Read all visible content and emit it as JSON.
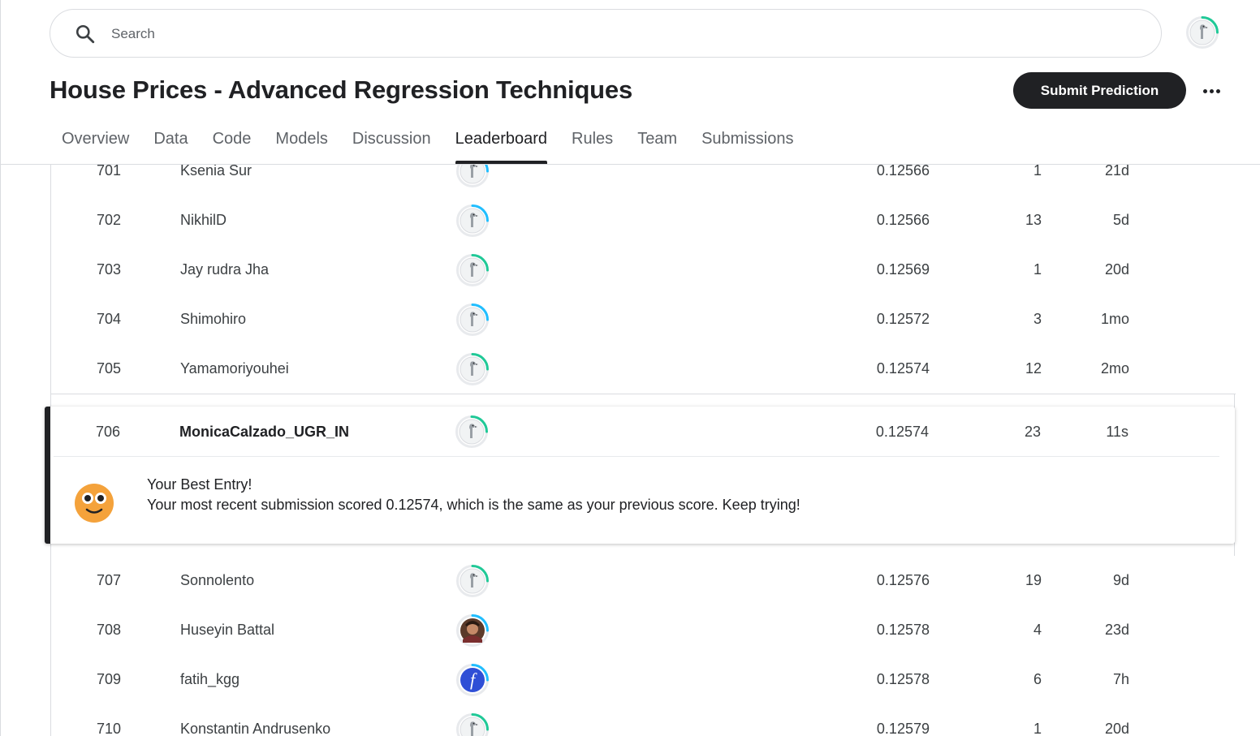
{
  "search": {
    "placeholder": "Search"
  },
  "competition": {
    "title": "House Prices - Advanced Regression Techniques",
    "submit_label": "Submit Prediction"
  },
  "tabs": [
    {
      "label": "Overview"
    },
    {
      "label": "Data"
    },
    {
      "label": "Code"
    },
    {
      "label": "Models"
    },
    {
      "label": "Discussion"
    },
    {
      "label": "Leaderboard",
      "active": true
    },
    {
      "label": "Rules"
    },
    {
      "label": "Team"
    },
    {
      "label": "Submissions"
    }
  ],
  "leaderboard": {
    "rows_before": [
      {
        "rank": "701",
        "name": "Ksenia Sur",
        "score": "0.12566",
        "entries": "1",
        "last": "21d",
        "avatar": "default-avatar",
        "ring": "#20beff"
      },
      {
        "rank": "702",
        "name": "NikhilD",
        "score": "0.12566",
        "entries": "13",
        "last": "5d",
        "avatar": "default-avatar",
        "ring": "#20beff"
      },
      {
        "rank": "703",
        "name": "Jay rudra Jha",
        "score": "0.12569",
        "entries": "1",
        "last": "20d",
        "avatar": "default-avatar",
        "ring": "#20c997"
      },
      {
        "rank": "704",
        "name": "Shimohiro",
        "score": "0.12572",
        "entries": "3",
        "last": "1mo",
        "avatar": "default-avatar",
        "ring": "#20beff"
      },
      {
        "rank": "705",
        "name": "Yamamoriyouhei",
        "score": "0.12574",
        "entries": "12",
        "last": "2mo",
        "avatar": "default-avatar",
        "ring": "#20c997"
      }
    ],
    "my_entry": {
      "rank": "706",
      "name": "MonicaCalzado_UGR_IN",
      "score": "0.12574",
      "entries": "23",
      "last": "11s",
      "avatar": "default-avatar",
      "ring": "#20c997",
      "message_title": "Your Best Entry!",
      "message_body": "Your most recent submission scored 0.12574, which is the same as your previous score. Keep trying!"
    },
    "rows_after": [
      {
        "rank": "707",
        "name": "Sonnolento",
        "score": "0.12576",
        "entries": "19",
        "last": "9d",
        "avatar": "default-avatar",
        "ring": "#20c997"
      },
      {
        "rank": "708",
        "name": "Huseyin Battal",
        "score": "0.12578",
        "entries": "4",
        "last": "23d",
        "avatar": "photo-avatar",
        "ring": "#20beff"
      },
      {
        "rank": "709",
        "name": "fatih_kgg",
        "score": "0.12578",
        "entries": "6",
        "last": "7h",
        "avatar": "letter-f-avatar",
        "ring": "#20beff"
      },
      {
        "rank": "710",
        "name": "Konstantin Andrusenko",
        "score": "0.12579",
        "entries": "1",
        "last": "20d",
        "avatar": "default-avatar",
        "ring": "#20c997"
      }
    ]
  },
  "colors": {
    "accent": "#202124",
    "tier_blue": "#20beff",
    "tier_green": "#20c997",
    "emoji": "#f4a23b"
  }
}
